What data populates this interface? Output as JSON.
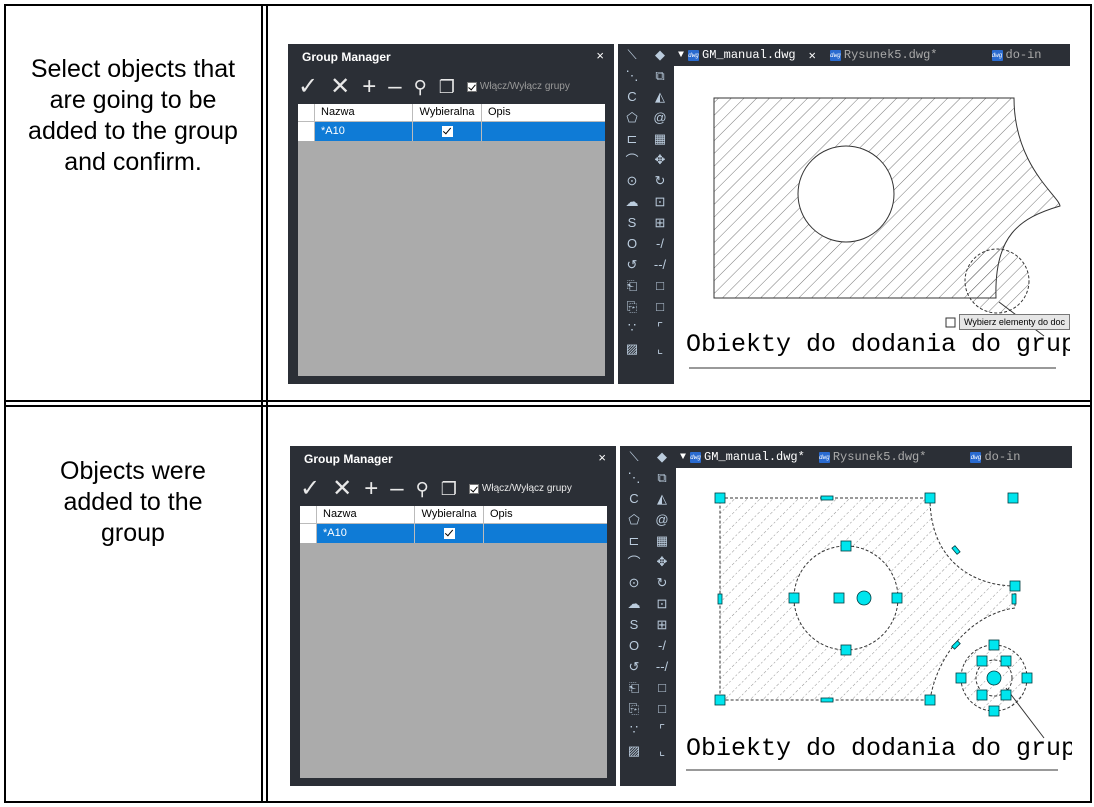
{
  "rows": [
    {
      "description": "Select objects that are going to be added to the group and confirm.",
      "lines": [
        "Select objects that",
        "are going to be",
        "added to the group",
        "and confirm."
      ],
      "group_manager": {
        "title": "Group Manager",
        "close": "×",
        "toolbar": [
          "✓",
          "✕",
          "+",
          "–",
          "⚲",
          "❐"
        ],
        "toggle_label": "Włącz/Wyłącz grupy",
        "columns": [
          "Nazwa",
          "Wybieralna",
          "Opis"
        ],
        "row": {
          "name": "*A10",
          "selectable": true,
          "desc": ""
        }
      },
      "tabs": [
        {
          "label": "GM_manual.dwg",
          "close": "✕"
        },
        {
          "label": "Rysunek5.dwg*",
          "close": ""
        },
        {
          "label": "do-in",
          "close": ""
        }
      ],
      "drawing_caption": "Obiekty do dodania do grupy",
      "tooltip": "Wybierz elementy do doc"
    },
    {
      "description": "Objects were added to the group",
      "lines": [
        "Objects were",
        "added to the",
        "group"
      ],
      "group_manager": {
        "title": "Group Manager",
        "close": "×",
        "toolbar": [
          "✓",
          "✕",
          "+",
          "–",
          "⚲",
          "❐"
        ],
        "toggle_label": "Włącz/Wyłącz grupy",
        "columns": [
          "Nazwa",
          "Wybieralna",
          "Opis"
        ],
        "row": {
          "name": "*A10",
          "selectable": true,
          "desc": ""
        }
      },
      "tabs": [
        {
          "label": "GM_manual.dwg*",
          "close": ""
        },
        {
          "label": "Rysunek5.dwg*",
          "close": ""
        },
        {
          "label": "do-in",
          "close": ""
        }
      ],
      "drawing_caption": "Obiekty do dodania do grupy"
    }
  ],
  "colors": {
    "panel": "#2b2f36",
    "selection": "#0f7bd6",
    "grip": "#00e5ee",
    "grid_bg": "#ababab"
  }
}
